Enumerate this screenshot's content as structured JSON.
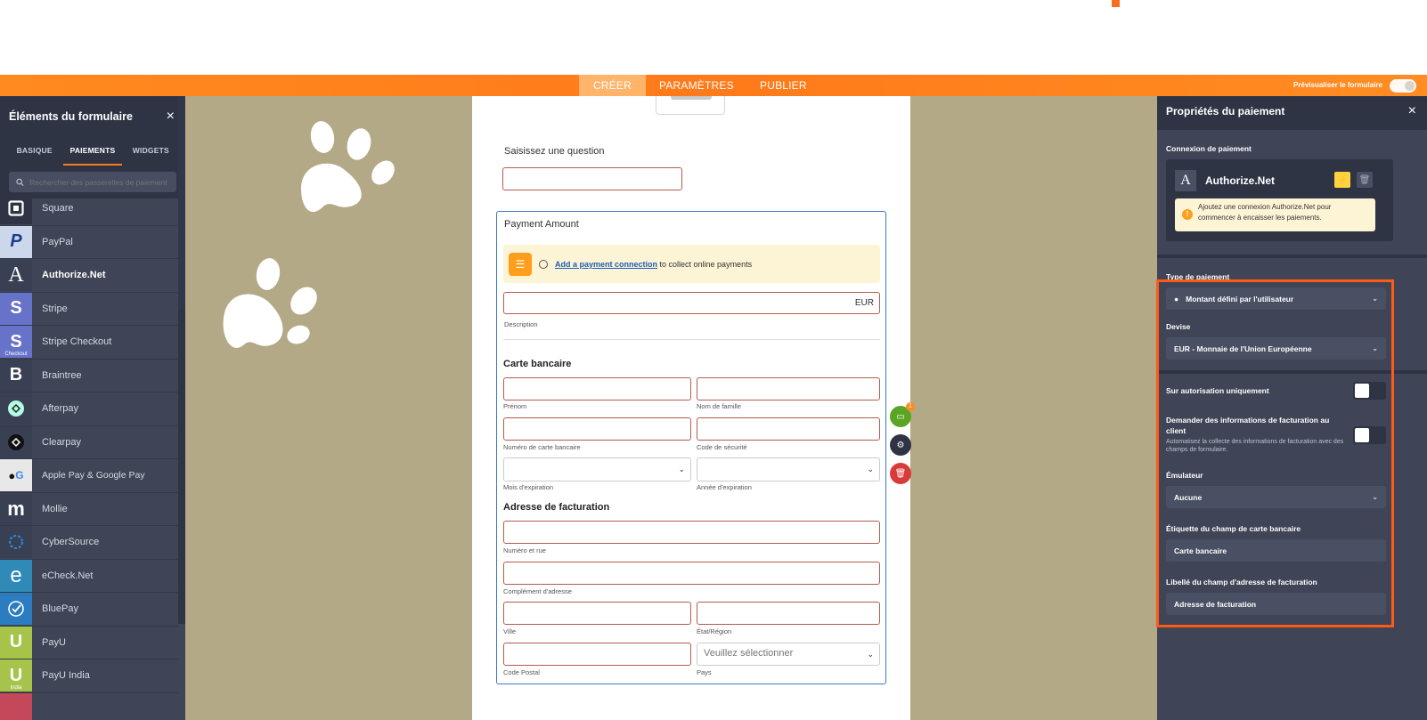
{
  "nav": {
    "tabs": [
      "CRÉER",
      "PARAMÈTRES",
      "PUBLIER"
    ],
    "preview_label": "Prévisualiser le formulaire"
  },
  "left_panel": {
    "title": "Éléments du formulaire",
    "close": "×",
    "tabs": [
      "BASIQUE",
      "PAIEMENTS",
      "WIDGETS"
    ],
    "search_placeholder": "Rechercher des passerelles de paiement",
    "items": [
      {
        "label": "Square",
        "icon": "square-icon"
      },
      {
        "label": "PayPal",
        "icon": "paypal-icon"
      },
      {
        "label": "Authorize.Net",
        "icon": "authorize-net-icon"
      },
      {
        "label": "Stripe",
        "icon": "stripe-icon"
      },
      {
        "label": "Stripe Checkout",
        "icon": "stripe-checkout-icon",
        "sub": "Checkout"
      },
      {
        "label": "Braintree",
        "icon": "braintree-icon"
      },
      {
        "label": "Afterpay",
        "icon": "afterpay-icon"
      },
      {
        "label": "Clearpay",
        "icon": "clearpay-icon"
      },
      {
        "label": "Apple Pay & Google Pay",
        "icon": "apple-google-pay-icon"
      },
      {
        "label": "Mollie",
        "icon": "mollie-icon"
      },
      {
        "label": "CyberSource",
        "icon": "cybersource-icon"
      },
      {
        "label": "eCheck.Net",
        "icon": "echeck-icon"
      },
      {
        "label": "BluePay",
        "icon": "bluepay-icon"
      },
      {
        "label": "PayU",
        "icon": "payu-icon"
      },
      {
        "label": "PayU India",
        "icon": "payu-india-icon",
        "sub": "India"
      }
    ]
  },
  "form": {
    "question_label": "Saisissez une question",
    "payment_title": "Payment Amount",
    "notice_link": "Add a payment connection",
    "notice_text": " to collect online payments",
    "currency": "EUR",
    "description_label": "Description",
    "card_section": "Carte bancaire",
    "first_name": "Prénom",
    "last_name": "Nom de famille",
    "card_number": "Numéro de carte bancaire",
    "security_code": "Code de sécurité",
    "exp_month": "Mois d'expiration",
    "exp_year": "Année d'expiration",
    "billing_section": "Adresse de facturation",
    "street": "Numéro et rue",
    "address2": "Complément d'adresse",
    "city": "Ville",
    "state": "État/Région",
    "zip": "Code Postal",
    "country_placeholder": "Veuillez sélectionner",
    "country": "Pays",
    "badge_count": "1"
  },
  "right_panel": {
    "title": "Propriétés du paiement",
    "close": "×",
    "connection_label": "Connexion de paiement",
    "connection_name": "Authorize.Net",
    "connection_warning": "Ajoutez une connexion Authorize.Net pour commencer à encaisser les paiements.",
    "payment_type_label": "Type de paiement",
    "payment_type_value": "Montant défini par l'utilisateur",
    "currency_label": "Devise",
    "currency_value": "EUR - Monnaie de l'Union Européenne",
    "auth_only_label": "Sur autorisation uniquement",
    "billing_info_label": "Demander des informations de facturation au client",
    "billing_info_desc": "Automatisez la collecte des informations de facturation avec des champs de formulaire.",
    "emulator_label": "Émulateur",
    "emulator_value": "Aucune",
    "card_field_label": "Étiquette du champ de carte bancaire",
    "card_field_value": "Carte bancaire",
    "billing_field_label": "Libellé du champ d'adresse de facturation",
    "billing_field_value": "Adresse de facturation"
  },
  "colors": {
    "orange": "#ff7a1a",
    "panel": "#3f4456",
    "panel_dark": "#2f3445",
    "canvas": "#b3a986",
    "highlight": "#ff5b17",
    "field_border": "#b35b4d"
  }
}
